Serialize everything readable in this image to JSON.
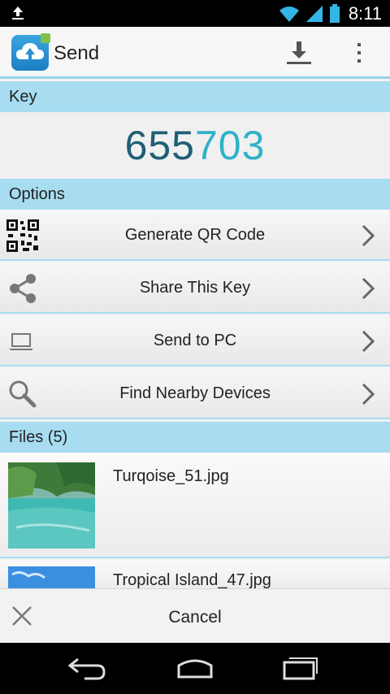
{
  "status_bar": {
    "time": "8:11"
  },
  "action_bar": {
    "title": "Send"
  },
  "key_section": {
    "header": "Key",
    "key_part1": "655",
    "key_part2": "703"
  },
  "options_section": {
    "header": "Options",
    "items": [
      {
        "label": "Generate QR Code",
        "icon": "qr-code-icon"
      },
      {
        "label": "Share This Key",
        "icon": "share-icon"
      },
      {
        "label": "Send to PC",
        "icon": "laptop-icon"
      },
      {
        "label": "Find Nearby Devices",
        "icon": "search-icon"
      }
    ]
  },
  "files_section": {
    "header": "Files (5)",
    "files": [
      {
        "name": "Turqoise_51.jpg"
      },
      {
        "name": "Tropical Island_47.jpg"
      }
    ]
  },
  "cancel_bar": {
    "label": "Cancel"
  },
  "colors": {
    "accent": "#a7dcf1",
    "key_dark": "#1f5f74",
    "key_light": "#2fb2c9"
  }
}
